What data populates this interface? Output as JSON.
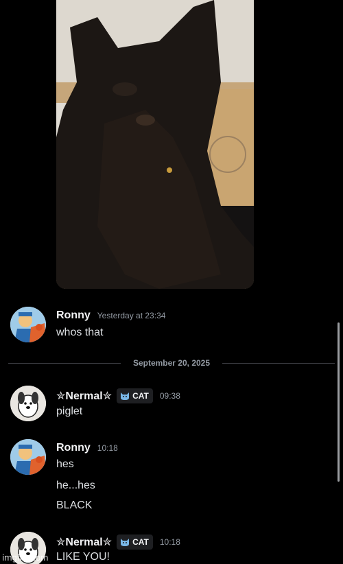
{
  "messages": [
    {
      "username": "Ronny",
      "timestamp": "Yesterday at 23:34",
      "lines": [
        "whos that"
      ]
    },
    {
      "username": "✮Nermal✮",
      "tag": "CAT",
      "timestamp": "09:38",
      "lines": [
        "piglet"
      ]
    },
    {
      "username": "Ronny",
      "timestamp": "10:18",
      "lines": [
        "hes",
        "he...hes",
        "BLACK"
      ]
    },
    {
      "username": "✮Nermal✮",
      "tag": "CAT",
      "timestamp": "10:18",
      "lines": [
        "LIKE YOU!"
      ]
    }
  ],
  "date_divider": "September 20, 2025",
  "watermark": "imgflip.com",
  "colors": {
    "background": "#000000",
    "username": "#f2f3f5",
    "timestamp": "#949ba4",
    "text": "#dbdee1",
    "tag_bg": "#1e1f22"
  },
  "icons": {
    "tag": "cat-face-icon",
    "avatar_ronny": "cartoon-avatar",
    "avatar_nermal": "cartoon-dog-avatar"
  }
}
